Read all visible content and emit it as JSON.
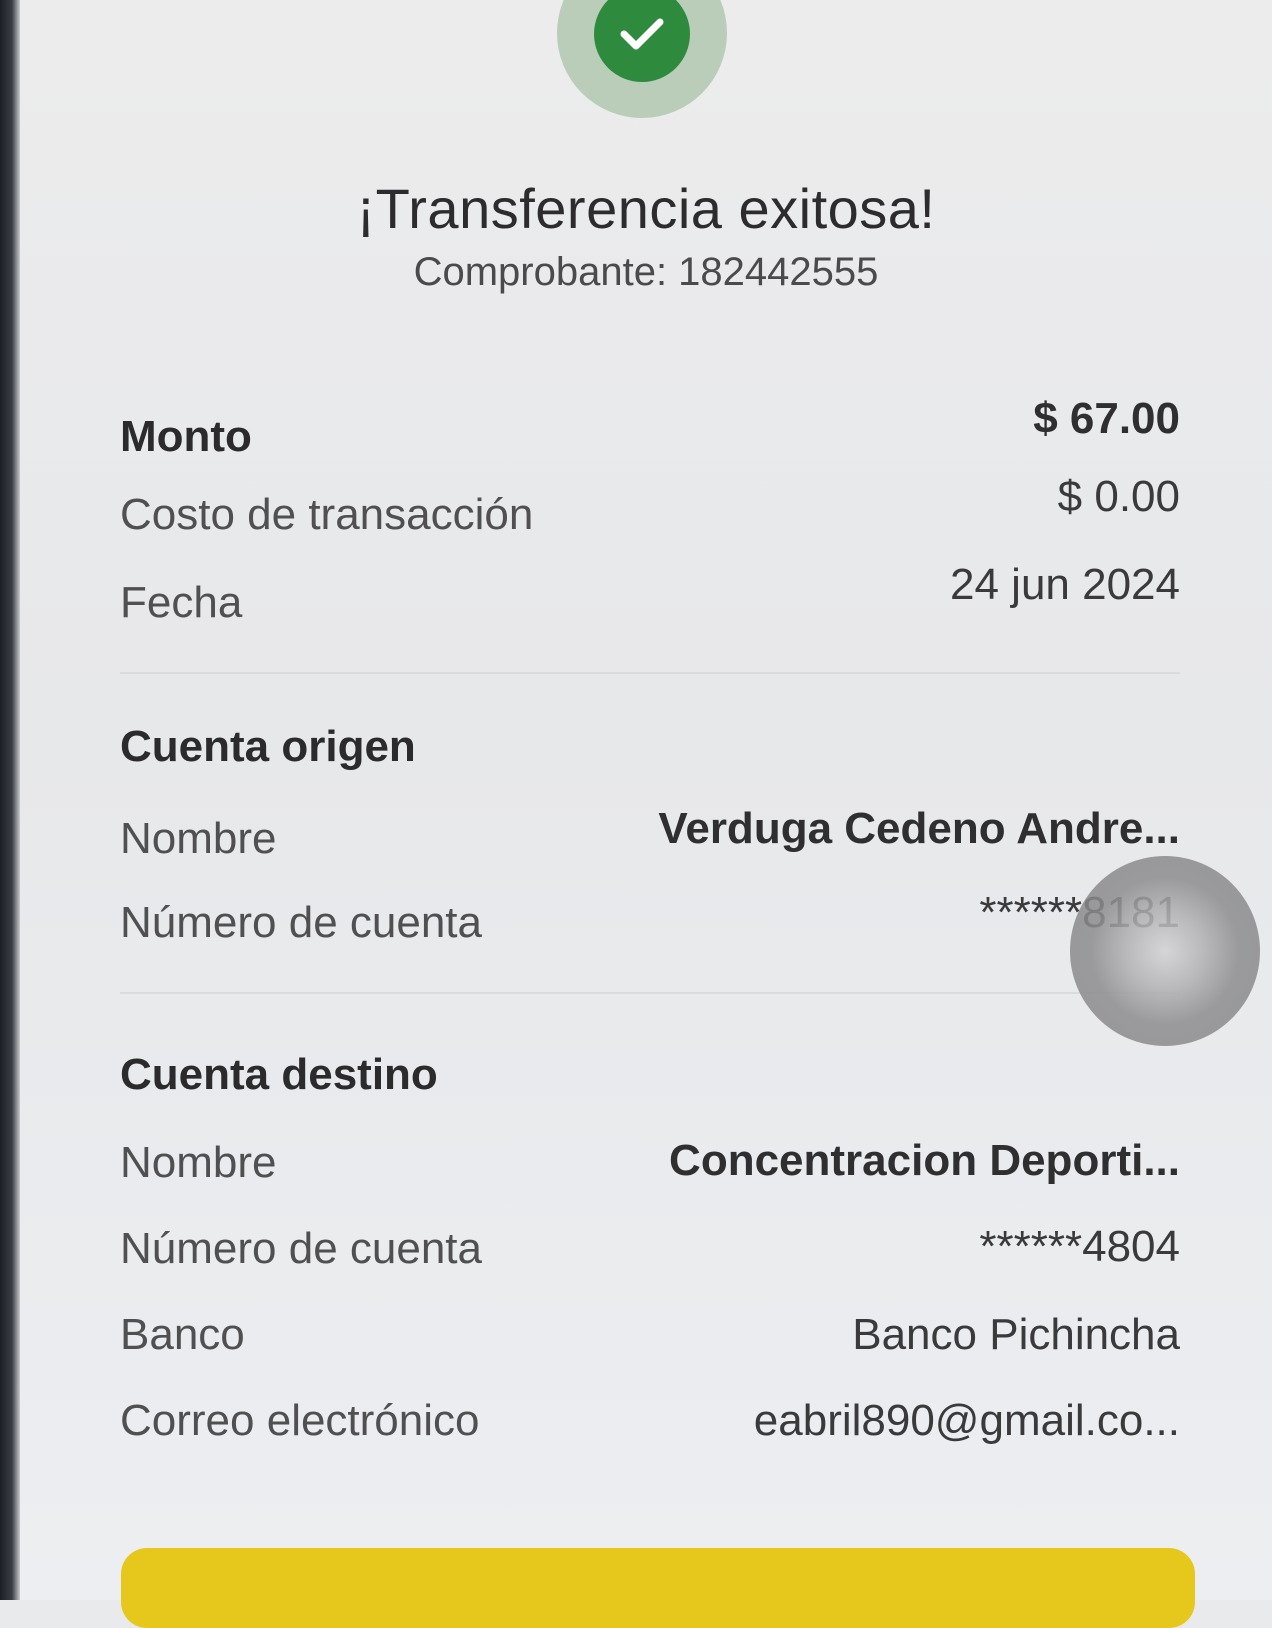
{
  "status": {
    "icon": "check-icon",
    "success_color": "#2e8b3d",
    "title": "¡Transferencia exitosa!",
    "receipt": "Comprobante: 182442555"
  },
  "summary": {
    "amount_label": "Monto",
    "amount_value": "$ 67.00",
    "fee_label": "Costo de transacción",
    "fee_value": "$ 0.00",
    "date_label": "Fecha",
    "date_value": "24 jun 2024"
  },
  "origin": {
    "section_title": "Cuenta origen",
    "name_label": "Nombre",
    "name_value": "Verduga  Cedeno Andre...",
    "account_label": "Número de cuenta",
    "account_value": "******8181"
  },
  "destination": {
    "section_title": "Cuenta destino",
    "name_label": "Nombre",
    "name_value": "Concentracion Deporti...",
    "account_label": "Número de cuenta",
    "account_value": "******4804",
    "bank_label": "Banco",
    "bank_value": "Banco Pichincha",
    "email_label": "Correo electrónico",
    "email_value": "eabril890@gmail.co..."
  },
  "cta": {
    "color": "#e6c81d"
  }
}
